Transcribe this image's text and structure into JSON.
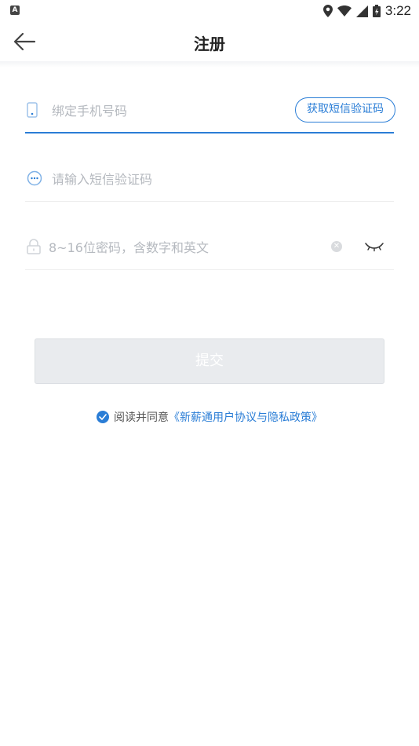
{
  "status_bar": {
    "time": "3:22",
    "notif_letter": "A"
  },
  "header": {
    "title": "注册"
  },
  "form": {
    "phone_placeholder": "绑定手机号码",
    "get_code_label": "获取短信验证码",
    "sms_placeholder": "请输入短信验证码",
    "password_placeholder": "8~16位密码，含数字和英文"
  },
  "submit_label": "提交",
  "agreement": {
    "prefix": "阅读并同意",
    "link": "《新薪通用户协议与隐私政策》",
    "checked": true
  },
  "colors": {
    "accent": "#2a7dd6",
    "placeholder": "#b5b9bf",
    "button_disabled": "#e9ebee"
  }
}
